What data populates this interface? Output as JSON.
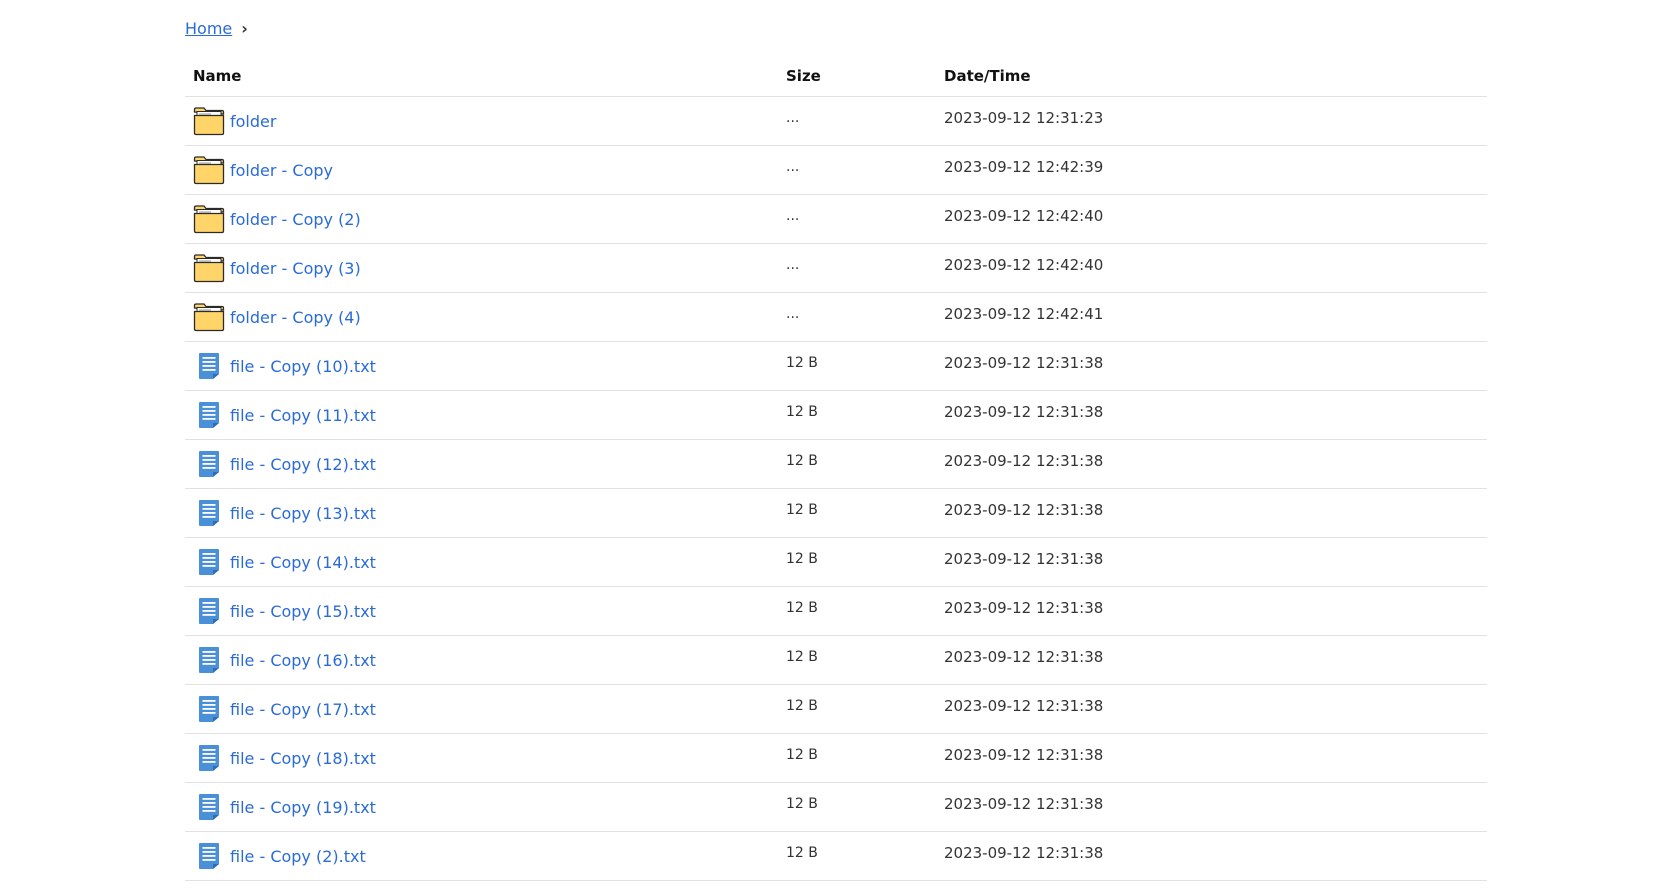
{
  "breadcrumb": {
    "home_label": "Home",
    "separator": "›"
  },
  "columns": {
    "name": "Name",
    "size": "Size",
    "date": "Date/Time"
  },
  "rows": [
    {
      "type": "folder",
      "name": "folder",
      "size": "...",
      "date": "2023-09-12 12:31:23"
    },
    {
      "type": "folder",
      "name": "folder - Copy",
      "size": "...",
      "date": "2023-09-12 12:42:39"
    },
    {
      "type": "folder",
      "name": "folder - Copy (2)",
      "size": "...",
      "date": "2023-09-12 12:42:40"
    },
    {
      "type": "folder",
      "name": "folder - Copy (3)",
      "size": "...",
      "date": "2023-09-12 12:42:40"
    },
    {
      "type": "folder",
      "name": "folder - Copy (4)",
      "size": "...",
      "date": "2023-09-12 12:42:41"
    },
    {
      "type": "file",
      "name": "file - Copy (10).txt",
      "size": "12 B",
      "date": "2023-09-12 12:31:38"
    },
    {
      "type": "file",
      "name": "file - Copy (11).txt",
      "size": "12 B",
      "date": "2023-09-12 12:31:38"
    },
    {
      "type": "file",
      "name": "file - Copy (12).txt",
      "size": "12 B",
      "date": "2023-09-12 12:31:38"
    },
    {
      "type": "file",
      "name": "file - Copy (13).txt",
      "size": "12 B",
      "date": "2023-09-12 12:31:38"
    },
    {
      "type": "file",
      "name": "file - Copy (14).txt",
      "size": "12 B",
      "date": "2023-09-12 12:31:38"
    },
    {
      "type": "file",
      "name": "file - Copy (15).txt",
      "size": "12 B",
      "date": "2023-09-12 12:31:38"
    },
    {
      "type": "file",
      "name": "file - Copy (16).txt",
      "size": "12 B",
      "date": "2023-09-12 12:31:38"
    },
    {
      "type": "file",
      "name": "file - Copy (17).txt",
      "size": "12 B",
      "date": "2023-09-12 12:31:38"
    },
    {
      "type": "file",
      "name": "file - Copy (18).txt",
      "size": "12 B",
      "date": "2023-09-12 12:31:38"
    },
    {
      "type": "file",
      "name": "file - Copy (19).txt",
      "size": "12 B",
      "date": "2023-09-12 12:31:38"
    },
    {
      "type": "file",
      "name": "file - Copy (2).txt",
      "size": "12 B",
      "date": "2023-09-12 12:31:38"
    }
  ],
  "icons": {
    "folder": "folder-icon",
    "file": "text-file-icon"
  },
  "colors": {
    "link": "#2a6bd8",
    "folder_fill": "#ffd56a",
    "folder_stroke": "#2b2b2b",
    "file_fill": "#4a90d9",
    "divider": "#e1e1e1"
  }
}
